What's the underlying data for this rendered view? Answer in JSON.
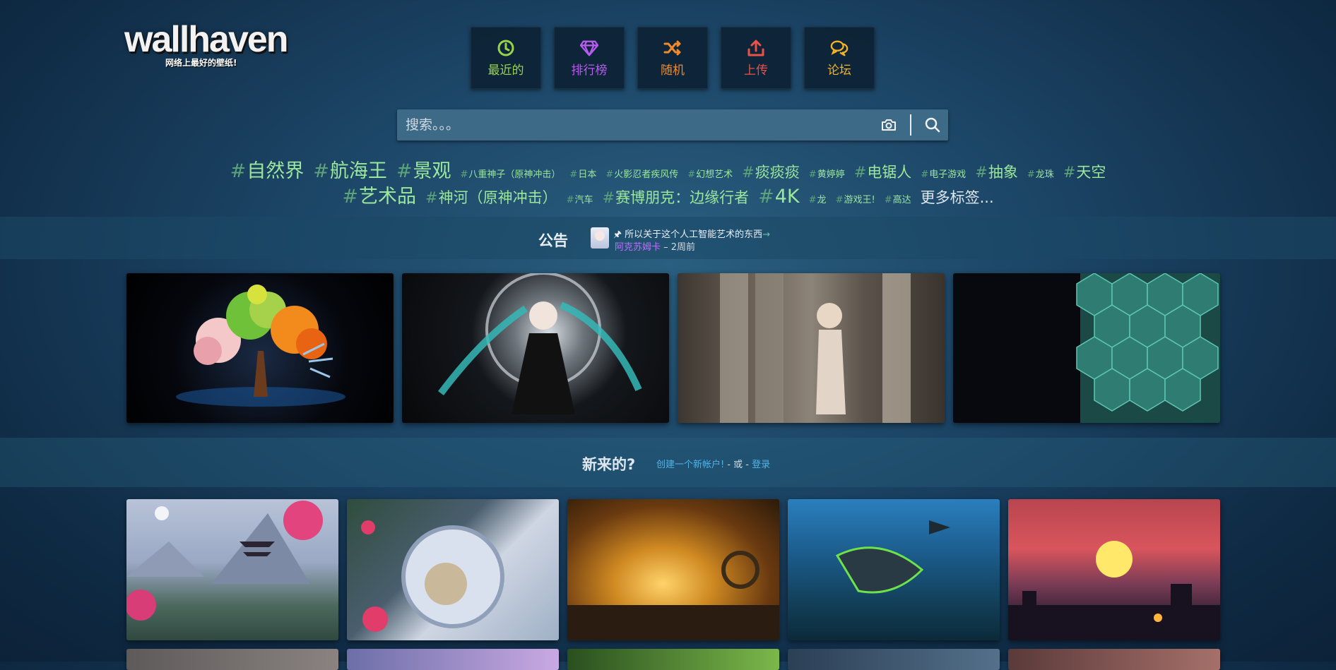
{
  "logo": {
    "wordmark": "wallhaven",
    "tagline": "网络上最好的壁纸!"
  },
  "nav": [
    {
      "key": "latest",
      "label": "最近的",
      "icon": "clock-icon",
      "color": "#98d44a"
    },
    {
      "key": "toplist",
      "label": "排行榜",
      "icon": "diamond-icon",
      "color": "#b85cf0"
    },
    {
      "key": "random",
      "label": "随机",
      "icon": "shuffle-icon",
      "color": "#ef8a2e"
    },
    {
      "key": "upload",
      "label": "上传",
      "icon": "upload-icon",
      "color": "#e8524a"
    },
    {
      "key": "forums",
      "label": "论坛",
      "icon": "chat-icon",
      "color": "#f2b324"
    }
  ],
  "search": {
    "placeholder": "搜索。。。",
    "camera_icon": "camera-icon",
    "search_icon": "search-icon"
  },
  "tags": {
    "row1": [
      {
        "label": "自然界",
        "size": "s1"
      },
      {
        "label": "航海王",
        "size": "s1"
      },
      {
        "label": "景观",
        "size": "s1"
      },
      {
        "label": "八重神子（原神冲击）",
        "size": "s3"
      },
      {
        "label": "日本",
        "size": "s3"
      },
      {
        "label": "火影忍者疾风传",
        "size": "s3"
      },
      {
        "label": "幻想艺术",
        "size": "s3"
      },
      {
        "label": "痰痰痰",
        "size": "s2"
      },
      {
        "label": "黄婷婷",
        "size": "s3"
      },
      {
        "label": "电锯人",
        "size": "s2"
      },
      {
        "label": "电子游戏",
        "size": "s3"
      },
      {
        "label": "抽象",
        "size": "s2"
      },
      {
        "label": "龙珠",
        "size": "s3"
      },
      {
        "label": "天空",
        "size": "s2"
      }
    ],
    "row2": [
      {
        "label": "艺术品",
        "size": "s1"
      },
      {
        "label": "神河（原神冲击）",
        "size": "s2"
      },
      {
        "label": "汽车",
        "size": "s3"
      },
      {
        "label": "赛博朋克：边缘行者",
        "size": "s2"
      },
      {
        "label": "4K",
        "size": "s1"
      },
      {
        "label": "龙",
        "size": "s3"
      },
      {
        "label": "游戏王!",
        "size": "s3"
      },
      {
        "label": "高达",
        "size": "s3"
      }
    ],
    "more": "更多标签..."
  },
  "announcement": {
    "title": "公告",
    "text": "所以关于这个人工智能艺术的东西",
    "arrow": "→",
    "author": "阿克苏姆卡",
    "time": " – 2周前"
  },
  "featured": [
    {
      "name": "featured-wallpaper-tree"
    },
    {
      "name": "featured-wallpaper-anime-girl"
    },
    {
      "name": "featured-wallpaper-columns-woman"
    },
    {
      "name": "featured-wallpaper-hexagons"
    }
  ],
  "newcomer": {
    "question": "新来的?",
    "create_link": "创建一个新帐户!",
    "or_text": " - 或 - ",
    "login_link": "登录"
  },
  "thumbnails": [
    {
      "name": "thumb-pagoda"
    },
    {
      "name": "thumb-astronaut-skull"
    },
    {
      "name": "thumb-forge"
    },
    {
      "name": "thumb-shark"
    },
    {
      "name": "thumb-sunset-city"
    },
    {
      "name": "thumb-row2-1"
    },
    {
      "name": "thumb-row2-2"
    },
    {
      "name": "thumb-row2-3"
    },
    {
      "name": "thumb-row2-4"
    },
    {
      "name": "thumb-row2-5"
    }
  ]
}
